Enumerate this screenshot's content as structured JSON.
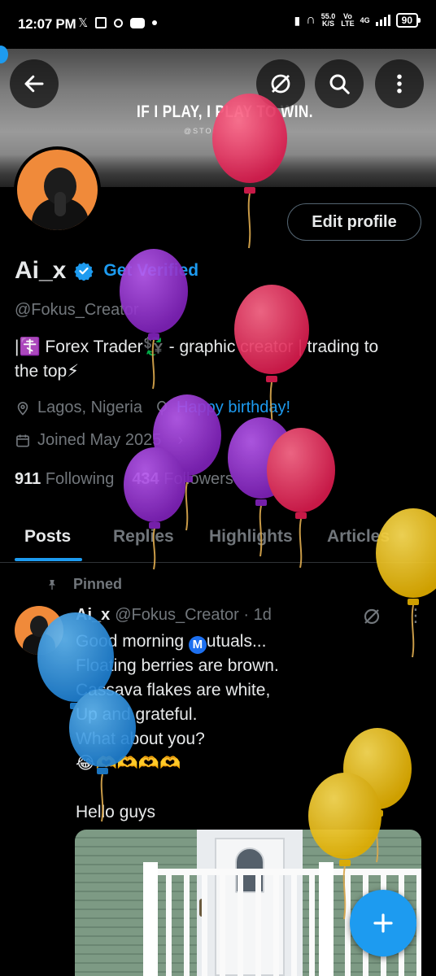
{
  "status_bar": {
    "time": "12:07 PM",
    "left_icons": [
      "x-icon",
      "calendar-icon",
      "circle-icon",
      "youtube-icon",
      "dot-icon"
    ],
    "net_speed_value": "55.0",
    "net_speed_unit": "K/S",
    "volte_top": "Vo",
    "volte_bottom": "LTE",
    "network_top": "4G",
    "battery": "90"
  },
  "banner": {
    "quote": "IF I PLAY, I PLAY TO WIN.",
    "watermark": "@STOI"
  },
  "profile": {
    "display_name": "Ai_x",
    "get_verified": "Get Verified",
    "handle": "@Fokus_Creator",
    "bio_line1": "|☦️ Forex Trader💱 - graphic creator | trading to",
    "bio_line2": "the top⚡",
    "location": "Lagos, Nigeria",
    "birthday": "Happy birthday!",
    "joined": "Joined May 2025",
    "following_count": "911",
    "following_label": "Following",
    "followers_count": "434",
    "followers_label": "Followers",
    "edit_profile": "Edit profile"
  },
  "tabs": [
    "Posts",
    "Replies",
    "Highlights",
    "Articles"
  ],
  "post": {
    "pinned_label": "Pinned",
    "author": "Ai_x",
    "handle_time": "@Fokus_Creator · 1d",
    "line1_pre": "Good morning ",
    "line1_badge": "M",
    "line1_post": "utuals...",
    "line2": "Floating berries are brown.",
    "line3": "Cassava flakes are white,",
    "line4": "Up and grateful.",
    "line5": "What about you?",
    "line6": "😂🫶🫶🫶🫶",
    "line7": "",
    "line8": "Hello guys"
  },
  "colors": {
    "accent": "#1d9bf0",
    "muted": "#71767b",
    "text": "#e7e9ea",
    "balloon_red": "#e8365f",
    "balloon_purple": "#9b2fd6",
    "balloon_blue": "#2f9be6",
    "balloon_yellow": "#f2c418"
  }
}
